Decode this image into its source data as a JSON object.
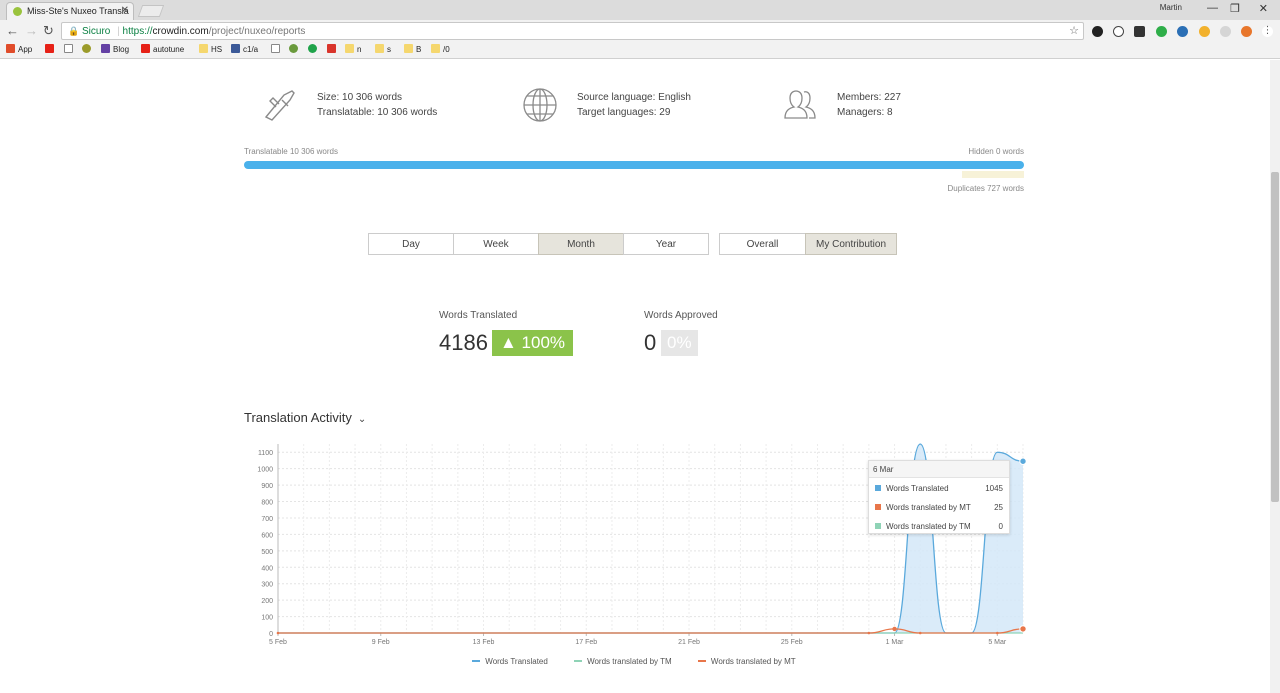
{
  "browser": {
    "tab_title": "Miss-Ste's Nuxeo Transla",
    "user": "Martin",
    "security_label": "Sicuro",
    "url_protocol": "https://",
    "url_host": "crowdin.com",
    "url_path": "/project/nuxeo/reports",
    "bookmarks": [
      "App",
      "",
      "",
      "",
      "Blog",
      "autotune",
      "HS",
      "",
      "c1/a",
      "",
      "",
      "",
      "",
      "n",
      "s",
      "B",
      "/0"
    ]
  },
  "project_stats": {
    "size": "Size: 10 306 words",
    "translatable": "Translatable: 10 306 words",
    "source_language": "Source language: English",
    "target_languages": "Target languages: 29",
    "members": "Members: 227",
    "managers": "Managers: 8"
  },
  "progress": {
    "translatable_label": "Translatable 10 306 words",
    "hidden_label": "Hidden 0 words",
    "duplicates_label": "Duplicates 727 words"
  },
  "period_tabs": [
    "Day",
    "Week",
    "Month",
    "Year"
  ],
  "period_active": "Month",
  "scope_tabs": [
    "Overall",
    "My Contribution"
  ],
  "scope_active": "My Contribution",
  "kpis": {
    "words_translated_label": "Words Translated",
    "words_translated_value": "4186",
    "words_translated_change": "▲ 100%",
    "words_approved_label": "Words Approved",
    "words_approved_value": "0",
    "words_approved_change": "0%"
  },
  "activity": {
    "title": "Translation Activity",
    "tooltip": {
      "date": "6 Mar",
      "rows": [
        {
          "label": "Words Translated",
          "value": "1045"
        },
        {
          "label": "Words translated by MT",
          "value": "25"
        },
        {
          "label": "Words translated by TM",
          "value": "0"
        }
      ]
    }
  },
  "colors": {
    "translated": "#5aa9dc",
    "translated_fill": "#d4e8f8",
    "mt": "#e8764a",
    "tm": "#8fd3b6",
    "green_badge": "#8bc34a",
    "progress_blue": "#4ab1eb"
  },
  "chart_data": {
    "type": "area",
    "ylim": [
      0,
      1150
    ],
    "yticks": [
      0,
      100,
      200,
      300,
      400,
      500,
      600,
      700,
      800,
      900,
      1000,
      1100
    ],
    "xtick_labels": [
      "5 Feb",
      "9 Feb",
      "13 Feb",
      "17 Feb",
      "21 Feb",
      "25 Feb",
      "1 Mar",
      "5 Mar"
    ],
    "xtick_days": [
      0,
      4,
      8,
      12,
      16,
      20,
      24,
      28
    ],
    "x_days_total": 29,
    "series": [
      {
        "name": "Words Translated",
        "color": "#5aa9dc",
        "points": [
          [
            0,
            0
          ],
          [
            23,
            0
          ],
          [
            24,
            0
          ],
          [
            25,
            1150
          ],
          [
            26,
            0
          ],
          [
            27,
            0
          ],
          [
            28,
            1100
          ],
          [
            29,
            1045
          ]
        ]
      },
      {
        "name": "Words translated by TM",
        "color": "#8fd3b6",
        "points": [
          [
            0,
            0
          ],
          [
            29,
            0
          ]
        ]
      },
      {
        "name": "Words translated by MT",
        "color": "#e8764a",
        "points": [
          [
            0,
            0
          ],
          [
            23,
            0
          ],
          [
            24,
            25
          ],
          [
            25,
            0
          ],
          [
            28,
            0
          ],
          [
            29,
            25
          ]
        ]
      }
    ]
  }
}
